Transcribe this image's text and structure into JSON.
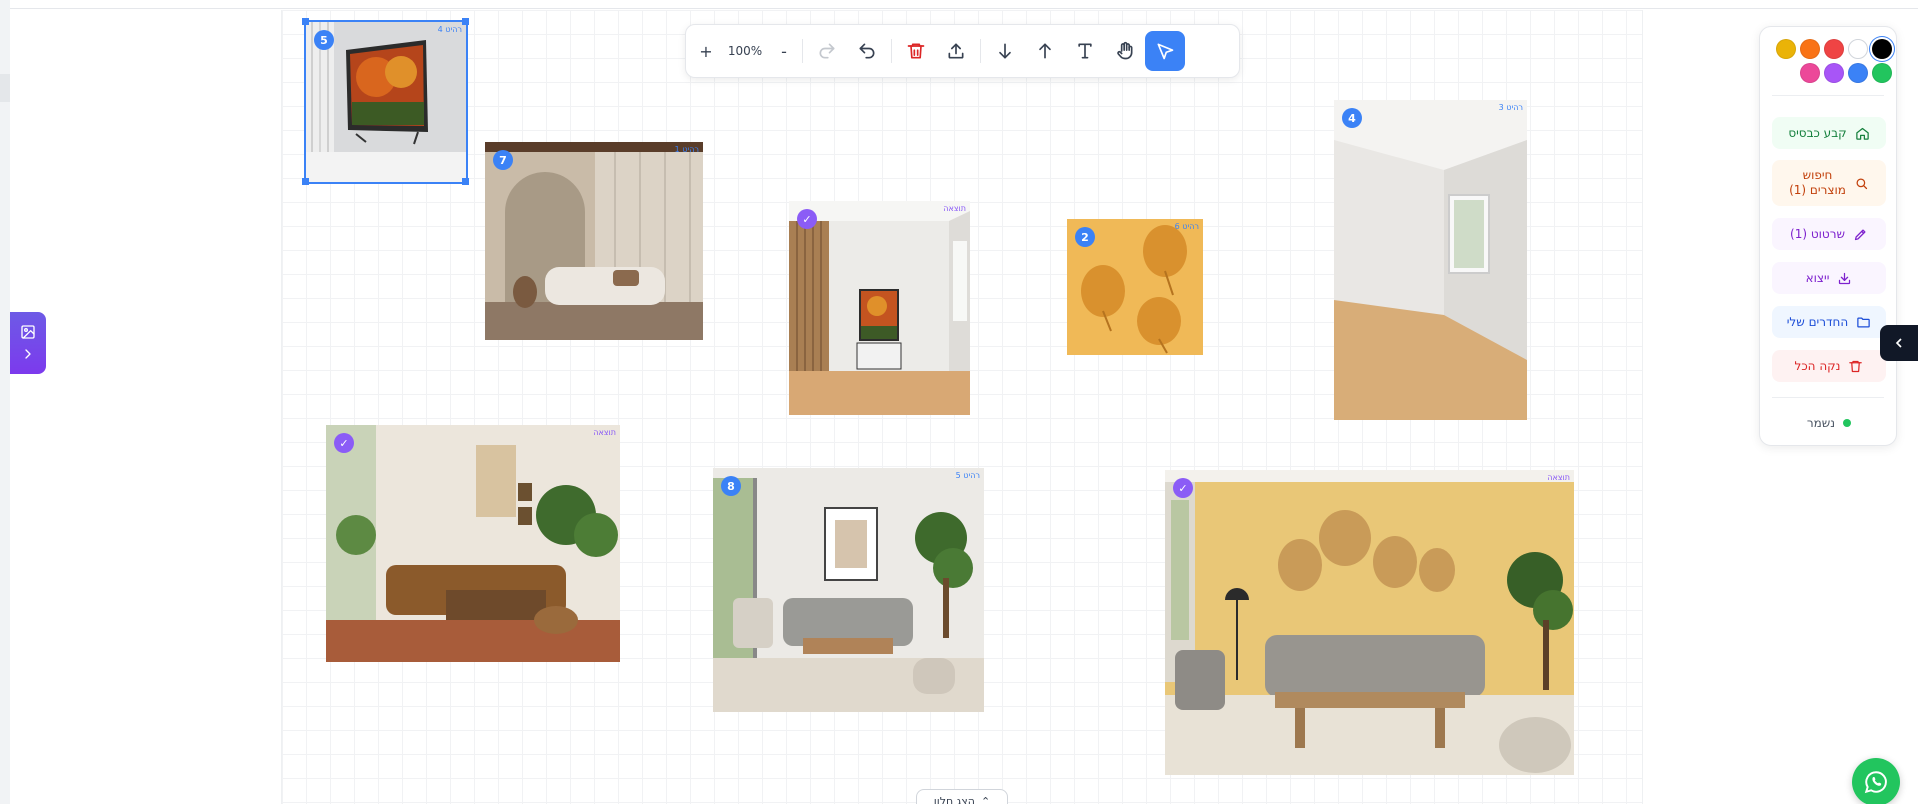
{
  "toolbar": {
    "zoom_in": "+",
    "zoom_level": "100%",
    "zoom_out": "-",
    "icons": [
      "redo-icon",
      "undo-icon",
      "trash-icon",
      "upload-icon",
      "arrow-down-icon",
      "arrow-up-icon",
      "text-icon",
      "hand-icon",
      "pointer-icon"
    ]
  },
  "images": [
    {
      "id": "img-tv",
      "badge": "5",
      "badge_color": "blue",
      "tag": "רהיט 4"
    },
    {
      "id": "img-arch-sofa",
      "badge": "7",
      "badge_color": "blue",
      "tag": "רהיט 1"
    },
    {
      "id": "img-hall-art",
      "badge": "✓",
      "badge_color": "purple",
      "tag": "תוצאה"
    },
    {
      "id": "img-leaves",
      "badge": "2",
      "badge_color": "blue",
      "tag": "רהיט 6"
    },
    {
      "id": "img-empty-room",
      "badge": "4",
      "badge_color": "blue",
      "tag": "רהיט 3"
    },
    {
      "id": "img-boho",
      "badge": "✓",
      "badge_color": "purple",
      "tag": "תוצאה"
    },
    {
      "id": "img-grey-sofa",
      "badge": "8",
      "badge_color": "blue",
      "tag": "רהיט 5"
    },
    {
      "id": "img-yellow-wall",
      "badge": "✓",
      "badge_color": "purple",
      "tag": "תוצאה"
    }
  ],
  "panel": {
    "colors": [
      "#eab308",
      "#f97316",
      "#ef4444",
      "#ffffff",
      "#000000",
      "#ec4899",
      "#a855f7",
      "#3b82f6",
      "#22c55e"
    ],
    "selected_color": "#000000",
    "set_base": "קבע כבסיס",
    "search_products_line1": "חיפוש",
    "search_products_line2": "מוצרים (1)",
    "sketch": "שרטוט (1)",
    "export": "ייצוא",
    "my_rooms": "החדרים שלי",
    "clear_all": "נקה הכל",
    "saved": "נשמר"
  },
  "bottom": {
    "show_panel": "הצג חלון"
  }
}
